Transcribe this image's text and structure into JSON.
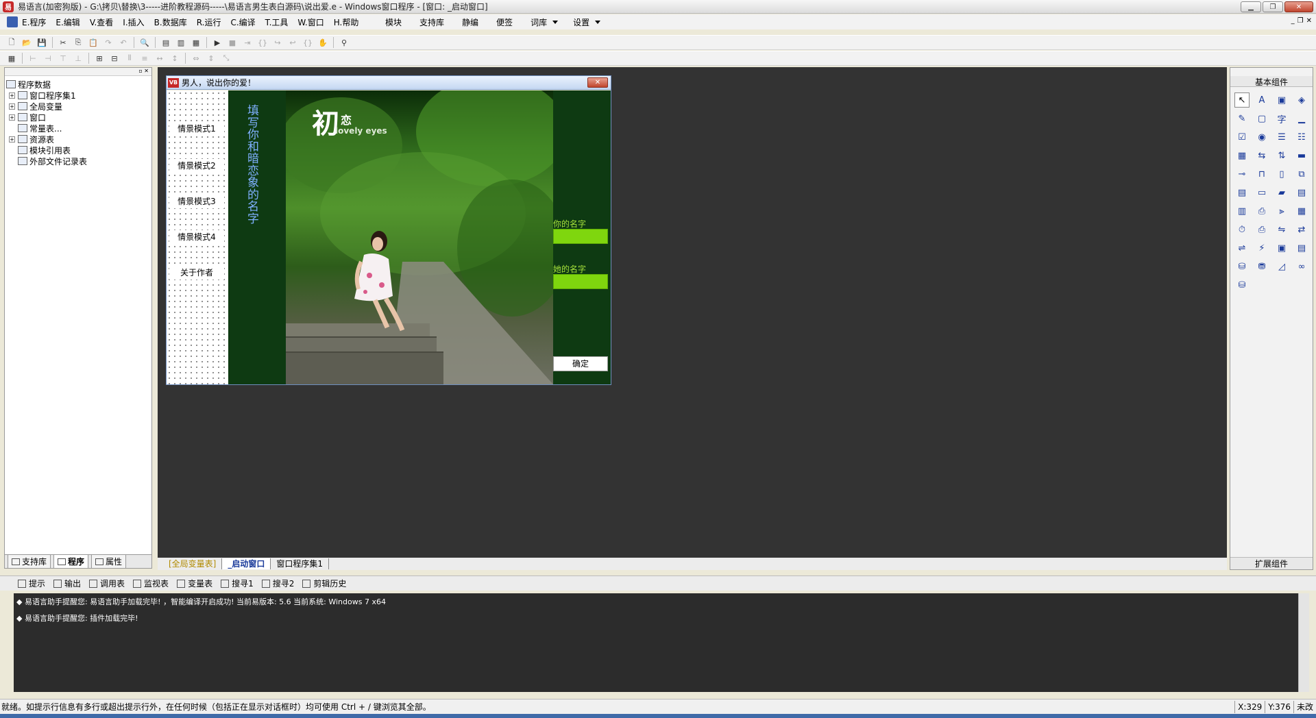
{
  "window": {
    "title": "易语言(加密狗版) - G:\\拷贝\\替换\\3-----进阶教程源码-----\\易语言男生表白源码\\说出爱.e - Windows窗口程序 - [窗口: _启动窗口]"
  },
  "menu": {
    "items": [
      "E.程序",
      "E.编辑",
      "V.查看",
      "I.插入",
      "B.数据库",
      "R.运行",
      "C.编译",
      "T.工具",
      "W.窗口",
      "H.帮助"
    ],
    "right": [
      "模块",
      "支持库",
      "静编",
      "便签",
      "词库",
      "设置"
    ]
  },
  "left_panel": {
    "tree": [
      "程序数据",
      "窗口程序集1",
      "全局变量",
      "窗口",
      "常量表...",
      "资源表",
      "模块引用表",
      "外部文件记录表"
    ],
    "tabs": [
      "支持库",
      "程序",
      "属性"
    ]
  },
  "form": {
    "title": "男人，说出你的爱！",
    "icon_text": "VB",
    "scene_buttons": [
      "情景模式1",
      "情景模式2",
      "情景模式3",
      "情景模式4",
      "关于作者"
    ],
    "vertical_text": "填写你和暗恋象的名字",
    "logo_main": "初",
    "logo_small": "恋",
    "logo_sub": "lovely eyes",
    "your_name_label": "你的名字",
    "her_name_label": "她的名字",
    "ok_button": "确定"
  },
  "doc_tabs": [
    "[全局变量表]",
    "_启动窗口",
    "窗口程序集1"
  ],
  "right_panel": {
    "title": "基本组件",
    "footer": "扩展组件"
  },
  "output": {
    "tabs": [
      "提示",
      "输出",
      "调用表",
      "监视表",
      "变量表",
      "搜寻1",
      "搜寻2",
      "剪辑历史"
    ],
    "lines": [
      "◆ 易语言助手提醒您: 易语言助手加载完毕! ，智能编译开启成功! 当前易版本: 5.6 当前系统: Windows 7 x64",
      "◆ 易语言助手提醒您: 插件加载完毕!"
    ]
  },
  "status": {
    "text": "就绪。如提示行信息有多行或超出提示行外，在任何时候（包括正在显示对话框时）均可使用 Ctrl + / 键浏览其全部。",
    "x": "X:329",
    "y": "Y:376",
    "mode": "未改"
  },
  "colors": {
    "design_bg": "#333333",
    "form_green": "#0e3a12",
    "input_green": "#7fd60e",
    "label_green": "#a6e23a",
    "vertical_text": "#7fb0ff"
  }
}
